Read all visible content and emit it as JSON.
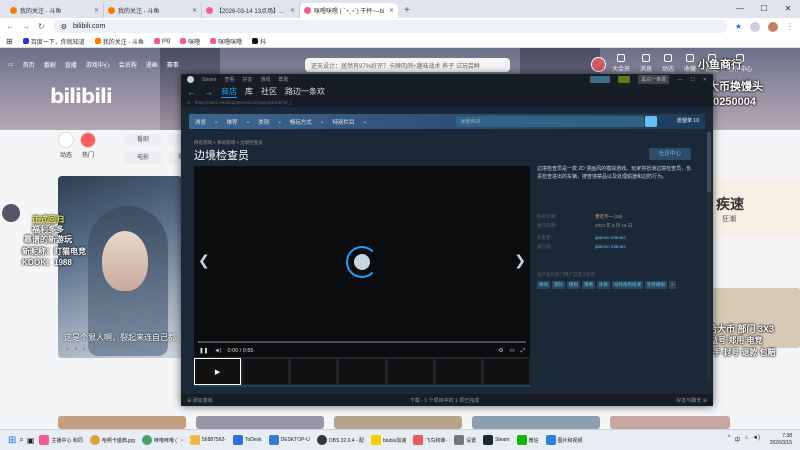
{
  "browser": {
    "tabs": [
      {
        "title": "我的关注 - 斗鱼"
      },
      {
        "title": "我的关注 - 斗鱼"
      },
      {
        "title": "【2026-03-14 13点场】pig的"
      },
      {
        "title": "咪噜咪噜 ( ´◔‸◔`) 干杯~--bi"
      }
    ],
    "new_tab": "+",
    "url": "bilibili.com",
    "bookmarks": [
      "百度一下，你就知道",
      "我的关注 - 斗鱼",
      "pig",
      "咪噜",
      "咪噜咪噜",
      "抖"
    ]
  },
  "bilibili": {
    "nav": [
      "首页",
      "番剧",
      "直播",
      "游戏中心",
      "会员购",
      "漫画",
      "赛事"
    ],
    "search_placeholder": "逆天设计：居然有97%好评？卡牌肉鸽+趣味战术 养子 试玩尝鲜",
    "logo": "bilibili",
    "right_icons": [
      "大会员",
      "消息",
      "动态",
      "收藏",
      "历史",
      "创作中心"
    ],
    "channels": [
      "动态",
      "热门"
    ],
    "pills": [
      "番剧",
      "电影",
      "国创",
      "电视剧"
    ],
    "hero_caption": "这是个狠人啊，裂起来连自己都",
    "streamer_overlay": [
      "正式回归",
      "福利多多",
      "靠谱的新游玩",
      "新昵称：盯猫电竞",
      "KOOK：1988"
    ],
    "right_overlay": [
      "小鱼商行",
      "哈大币换馒头",
      "cai20250004"
    ],
    "right_bottom_overlay": [
      "代肝哈大币 部门 3X3",
      "公益号 郑用 电竞",
      "招打手 封号 退款 包赔"
    ],
    "right_card_text": [
      "疾速",
      "狂潮"
    ]
  },
  "steam": {
    "title_menu": [
      "Steam",
      "查看",
      "好友",
      "游戏",
      "帮助"
    ],
    "account": "黑白一条尾",
    "main_tabs": [
      "商店",
      "库",
      "社区",
      "路边一条欢"
    ],
    "url": "https://store.steampowered.com/app/3134670/_/",
    "store_nav": [
      "浏览",
      "推荐",
      "类别",
      "畅玩方式",
      "特别栏目"
    ],
    "search_placeholder": "搜索商店",
    "wishlist": "愿望单 10",
    "breadcrumb": "所有游戏 > 休闲游戏 > 边境检查员",
    "game_title": "边境检查员",
    "community_hub": "社区中心",
    "video_time": "0:00 / 0:55",
    "description": "边境检查员是一款 2D 漫画风的模拟游戏。玩家将扮演边境检查员，负责检查进出的车辆，搜查违禁品以及处理偷渡和边防行为。",
    "details": [
      {
        "key": "所有评测：",
        "value": "褒贬不一 (19)",
        "style": "mix"
      },
      {
        "key": "发行日期：",
        "value": "2024 年 8 月 16 日",
        "style": ""
      },
      {
        "key": "开发者：",
        "value": "qianmo interact",
        "style": "link"
      },
      {
        "key": "发行商：",
        "value": "qianmo interact",
        "style": "link"
      }
    ],
    "tags_label": "该产品的热门用户自定义标签：",
    "tags": [
      "休闲",
      "冒险",
      "模拟",
      "策略",
      "体育",
      "动作角色扮演",
      "生存模拟",
      "+"
    ],
    "footer_left": "添加游戏",
    "footer_mid": "下载 - 1 个项目中的 1 项已完成",
    "footer_right": "好友与聊天"
  },
  "taskbar": {
    "items": [
      "主播中心 和同",
      "哈啊卡盛典.jpg",
      "咪噜咪噜 ( ´◔",
      "56887562-",
      "ToDesk",
      "DESKTOP-U",
      "OBS 32.0.4 - 配",
      "biubiu加速",
      "飞鸟和蝉-",
      "设置",
      "Steam",
      "微信",
      "图片和视频"
    ],
    "tray": "中",
    "time": "7:38",
    "date": "2026/3/15"
  }
}
